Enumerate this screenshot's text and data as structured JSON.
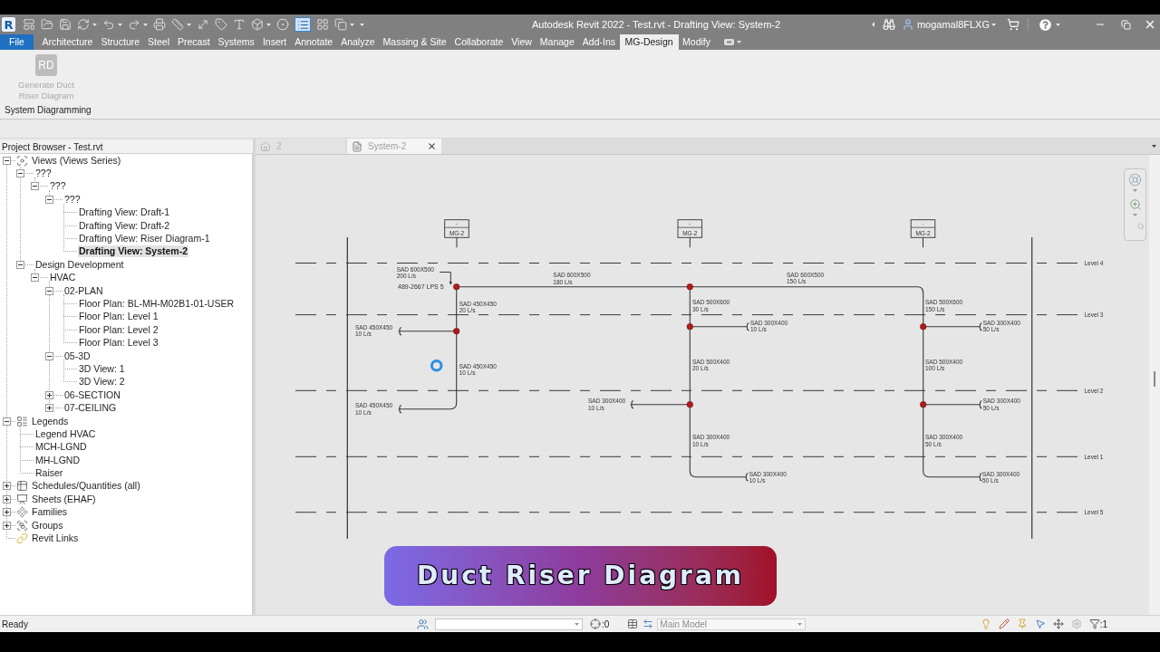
{
  "title_bar": {
    "logo": "R",
    "title": "Autodesk Revit 2022 - Test.rvt - Drafting View: System-2",
    "user": "mogamal8FLXG"
  },
  "ribbon_tabs": [
    {
      "label": "File",
      "kind": "application_menu",
      "selected": false
    },
    {
      "label": "Architecture",
      "kind": "tab",
      "selected": false
    },
    {
      "label": "Structure",
      "kind": "tab",
      "selected": false
    },
    {
      "label": "Steel",
      "kind": "tab",
      "selected": false
    },
    {
      "label": "Precast",
      "kind": "tab",
      "selected": false
    },
    {
      "label": "Systems",
      "kind": "tab",
      "selected": false
    },
    {
      "label": "Insert",
      "kind": "tab",
      "selected": false
    },
    {
      "label": "Annotate",
      "kind": "tab",
      "selected": false
    },
    {
      "label": "Analyze",
      "kind": "tab",
      "selected": false
    },
    {
      "label": "Massing & Site",
      "kind": "tab",
      "selected": false
    },
    {
      "label": "Collaborate",
      "kind": "tab",
      "selected": false
    },
    {
      "label": "View",
      "kind": "tab",
      "selected": false
    },
    {
      "label": "Manage",
      "kind": "tab",
      "selected": false
    },
    {
      "label": "Add-Ins",
      "kind": "tab",
      "selected": false
    },
    {
      "label": "MG-Design",
      "kind": "tab",
      "selected": true
    },
    {
      "label": "Modify",
      "kind": "tab",
      "selected": false
    }
  ],
  "ribbon_panel": {
    "commands": [
      {
        "icon_text": "RD",
        "label": "Generate Duct Riser Diagram",
        "disabled": true
      }
    ],
    "title": "System Diagramming"
  },
  "project_browser": {
    "title": "Project Browser - Test.rvt",
    "tree": [
      {
        "label": "Views (Views Series)",
        "kind": "views",
        "expanded": true,
        "selected": false,
        "children": [
          {
            "label": "???",
            "expanded": true,
            "selected": false,
            "children": [
              {
                "label": "???",
                "expanded": true,
                "selected": false,
                "children": [
                  {
                    "label": "???",
                    "expanded": true,
                    "selected": false,
                    "children": [
                      {
                        "label": "Drafting View: Draft-1",
                        "selected": false
                      },
                      {
                        "label": "Drafting View: Draft-2",
                        "selected": false
                      },
                      {
                        "label": "Drafting View: Riser Diagram-1",
                        "selected": false
                      },
                      {
                        "label": "Drafting View: System-2",
                        "selected": true
                      }
                    ]
                  }
                ]
              }
            ]
          },
          {
            "label": "Design Development",
            "expanded": true,
            "selected": false,
            "children": [
              {
                "label": "HVAC",
                "expanded": true,
                "selected": false,
                "children": [
                  {
                    "label": "02-PLAN",
                    "expanded": true,
                    "selected": false,
                    "children": [
                      {
                        "label": "Floor Plan: BL-MH-M02B1-01-USER",
                        "selected": false
                      },
                      {
                        "label": "Floor Plan: Level 1",
                        "selected": false
                      },
                      {
                        "label": "Floor Plan: Level 2",
                        "selected": false
                      },
                      {
                        "label": "Floor Plan: Level 3",
                        "selected": false
                      }
                    ]
                  },
                  {
                    "label": "05-3D",
                    "expanded": true,
                    "selected": false,
                    "children": [
                      {
                        "label": "3D View: 1",
                        "selected": false
                      },
                      {
                        "label": "3D View: 2",
                        "selected": false
                      }
                    ]
                  },
                  {
                    "label": "06-SECTION",
                    "expanded": false,
                    "selected": false
                  },
                  {
                    "label": "07-CEILING",
                    "expanded": false,
                    "selected": false
                  }
                ]
              }
            ]
          }
        ]
      },
      {
        "label": "Legends",
        "kind": "legends",
        "expanded": true,
        "selected": false,
        "children": [
          {
            "label": "Legend HVAC",
            "selected": false
          },
          {
            "label": "MCH-LGND",
            "selected": false
          },
          {
            "label": "MH-LGND",
            "selected": false
          },
          {
            "label": "Raiser",
            "selected": false
          }
        ]
      },
      {
        "label": "Schedules/Quantities (all)",
        "kind": "schedules",
        "expanded": false,
        "selected": false
      },
      {
        "label": "Sheets (EHAF)",
        "kind": "sheets",
        "expanded": false,
        "selected": false
      },
      {
        "label": "Families",
        "kind": "families",
        "expanded": false,
        "selected": false
      },
      {
        "label": "Groups",
        "kind": "groups",
        "expanded": false,
        "selected": false
      },
      {
        "label": "Revit Links",
        "kind": "links",
        "selected": false
      }
    ]
  },
  "view_tabs": [
    {
      "label": "2",
      "kind": "model",
      "selected": false
    },
    {
      "label": "System-2",
      "kind": "drafting",
      "selected": true
    }
  ],
  "diagram": {
    "equipment_tags": [
      {
        "top": "-",
        "bottom": "MG-2"
      },
      {
        "top": "-",
        "bottom": "MG-2"
      },
      {
        "top": "-",
        "bottom": "MG-2"
      }
    ],
    "levels": [
      "Level 4",
      "Level 3",
      "Level 2",
      "Level 1",
      "Level 5"
    ],
    "duct_labels": [
      {
        "size": "SAD 600X500",
        "flow": "200 L/s"
      },
      {
        "size": "SAD 600X500",
        "flow": "180 L/s"
      },
      {
        "size": "SAD 600X500",
        "flow": "150 L/s"
      },
      {
        "size": "SAD 450X450",
        "flow": "20 L/s"
      },
      {
        "size": "SAD 500X600",
        "flow": "30 L/s"
      },
      {
        "size": "SAD 500X600",
        "flow": "150 L/s"
      },
      {
        "size": "SAD 300X400",
        "flow": "10 L/s"
      },
      {
        "size": "SAD 300X400",
        "flow": "50 L/s"
      },
      {
        "size": "SAD 450X450",
        "flow": "10 L/s"
      },
      {
        "size": "SAD 500X400",
        "flow": "20 L/s"
      },
      {
        "size": "SAD 500X400",
        "flow": "100 L/s"
      },
      {
        "size": "SAD 450X450",
        "flow": "10 L/s"
      },
      {
        "size": "SAD 300X400",
        "flow": "10 L/s"
      },
      {
        "size": "SAD 300X400",
        "flow": "50 L/s"
      },
      {
        "size": "SAD 450X450",
        "flow": "10 L/s"
      },
      {
        "size": "SAD 300X400",
        "flow": "10 L/s"
      },
      {
        "size": "SAD 300X400",
        "flow": "50 L/s"
      },
      {
        "size": "SAD 300X400",
        "flow": "10 L/s"
      },
      {
        "size": "SAD 300X400",
        "flow": "50 L/s"
      }
    ],
    "note": "489-2667 LPS 5"
  },
  "caption_banner": "Duct Riser Diagram",
  "status_bar": {
    "message": "Ready",
    "selection_count": ":0",
    "model_selector": {
      "value": "Main Model",
      "disabled": true
    },
    "filter_count": ":1"
  }
}
